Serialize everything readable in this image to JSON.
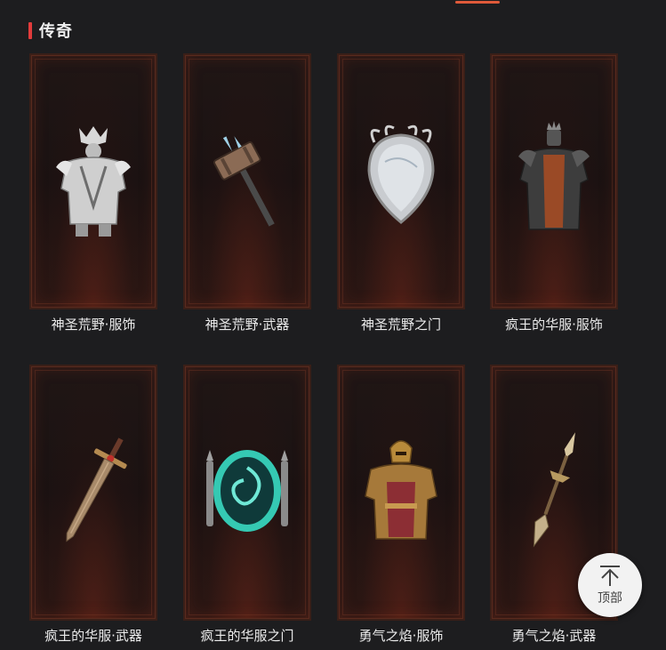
{
  "section": {
    "title": "传奇"
  },
  "items": [
    {
      "name": "神圣荒野·服饰",
      "icon": "armor-white-icon"
    },
    {
      "name": "神圣荒野·武器",
      "icon": "hammer-icon"
    },
    {
      "name": "神圣荒野之门",
      "icon": "mirror-portal-icon"
    },
    {
      "name": "疯王的华服·服饰",
      "icon": "armor-dark-icon"
    },
    {
      "name": "疯王的华服·武器",
      "icon": "sword-red-icon"
    },
    {
      "name": "疯王的华服之门",
      "icon": "portal-teal-icon"
    },
    {
      "name": "勇气之焰·服饰",
      "icon": "armor-gold-icon"
    },
    {
      "name": "勇气之焰·武器",
      "icon": "spear-gold-icon"
    }
  ],
  "back_to_top": {
    "label": "顶部",
    "icon": "arrow-up-bar-icon"
  }
}
